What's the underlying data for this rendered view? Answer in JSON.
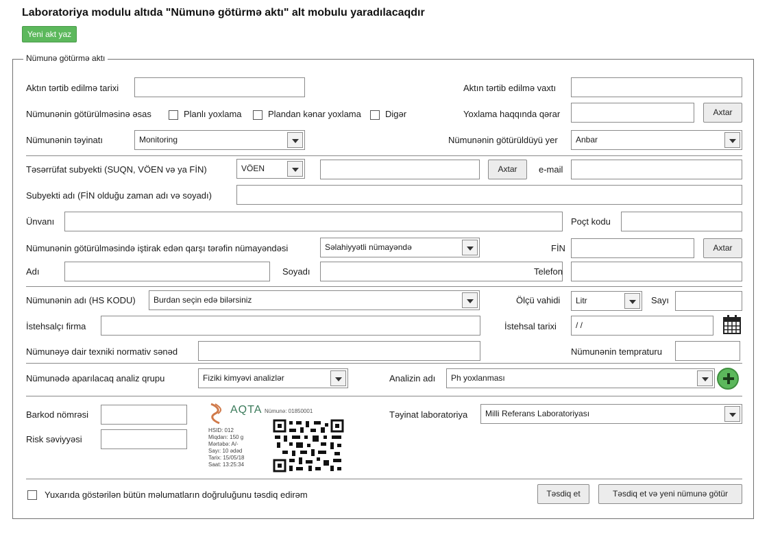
{
  "page_title": "Laboratoriya modulu altıda \"Nümunə götürmə aktı\" alt mobulu yaradılacaqdır",
  "new_act_button": "Yeni akt yaz",
  "form_legend": "Nümunə götürmə aktı",
  "row1": {
    "date_label": "Aktın tərtib edilmə tarixi",
    "date_value": "",
    "time_label": "Aktın tərtib edilmə vaxtı",
    "time_value": ""
  },
  "row2": {
    "basis_label": "Nümunənin götürülməsinə əsas",
    "opt_planned": "Planlı yoxlama",
    "opt_unplanned": "Plandan kənar yoxlama",
    "opt_other": "Digər",
    "decision_label": "Yoxlama haqqında qərar",
    "decision_value": "",
    "search_button": "Axtar"
  },
  "row3": {
    "purpose_label": "Nümunənin təyinatı",
    "purpose_value": "Monitoring",
    "place_label": "Nümunənin götürüldüyü yer",
    "place_value": "Anbar"
  },
  "row4": {
    "subject_label": "Təsərrüfat subyekti (SUQN, VÖEN və ya FİN)",
    "id_type_value": "VÖEN",
    "id_value": "",
    "search_button": "Axtar",
    "email_label": "e-mail",
    "email_value": ""
  },
  "row5": {
    "subject_name_label": "Subyekti adı (FİN olduğu zaman adı və soyadı)",
    "subject_name_value": ""
  },
  "row6": {
    "address_label": "Ünvanı",
    "address_value": "",
    "postal_label": "Poçt kodu",
    "postal_value": ""
  },
  "row7": {
    "rep_label": "Nümunənin götürülməsində iştirak edən qarşı tərəfin nümayəndəsi",
    "rep_value": "Səlahiyyətli nümayəndə",
    "fin_label": "FİN",
    "fin_value": "",
    "search_button": "Axtar"
  },
  "row8": {
    "first_name_label": "Adı",
    "first_name_value": "",
    "last_name_label": "Soyadı",
    "last_name_value": "",
    "phone_label": "Telefon",
    "phone_value": ""
  },
  "row9": {
    "sample_name_label": "Nümunənin adı (HS KODU)",
    "sample_name_value": "Burdan seçin edə bilərsiniz",
    "unit_label": "Ölçü vahidi",
    "unit_value": "Litr",
    "count_label": "Sayı",
    "count_value": ""
  },
  "row10": {
    "manufacturer_label": "İstehsalçı firma",
    "manufacturer_value": "",
    "prod_date_label": "İstehsal tarixi",
    "prod_date_value": "/ /"
  },
  "row11": {
    "normative_label": "Nümunəyə dair texniki normativ sənəd",
    "normative_value": "",
    "temp_label": "Nümunənin tempraturu",
    "temp_value": ""
  },
  "row12": {
    "group_label": "Nümunədə aparılacaq analiz qrupu",
    "group_value": "Fiziki kimyəvi analizlər",
    "analysis_label": "Analizin adı",
    "analysis_value": "Ph yoxlanması"
  },
  "barcode": {
    "barcode_label": "Barkod nömrəsi",
    "risk_label": "Risk səviyyəsi",
    "brand": "AQTA",
    "sample_no": "Nümunə: 01850001",
    "lines": [
      "HSID: 012",
      "Miqdarı: 150 g",
      "Mərtəbə: A/-",
      "Sayı: 10 ədəd",
      "Tarix: 15/05/18",
      "Saat: 13:25:34"
    ],
    "lab_label": "Təyinat laboratoriya",
    "lab_value": "Milli Referans Laboratoriyası"
  },
  "footer": {
    "confirm_text": "Yuxarıda göstərilən bütün məlumatların doğruluğunu təsdiq edirəm",
    "confirm_button": "Təsdiq et",
    "confirm_new_button": "Təsdiq et və yeni nümunə götür"
  },
  "colors": {
    "accent_green": "#5cb85c"
  }
}
